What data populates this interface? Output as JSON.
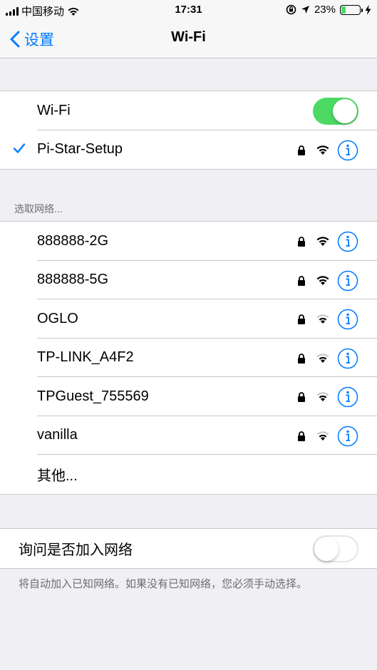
{
  "status": {
    "carrier": "中国移动",
    "time": "17:31",
    "battery_pct": "23%",
    "battery_level": 0.23
  },
  "nav": {
    "back_label": "设置",
    "title": "Wi-Fi"
  },
  "wifi_section": {
    "toggle_label": "Wi-Fi",
    "toggle_on": true,
    "connected": "Pi-Star-Setup"
  },
  "choose_header": "选取网络...",
  "networks": [
    {
      "name": "888888-2G",
      "strength": 3
    },
    {
      "name": "888888-5G",
      "strength": 3
    },
    {
      "name": "OGLO",
      "strength": 2
    },
    {
      "name": "TP-LINK_A4F2",
      "strength": 2
    },
    {
      "name": "TPGuest_755569",
      "strength": 2
    },
    {
      "name": "vanilla",
      "strength": 2
    }
  ],
  "other_label": "其他...",
  "ask_join": {
    "label": "询问是否加入网络",
    "toggle_on": false,
    "note": "将自动加入已知网络。如果没有已知网络，您必须手动选择。"
  },
  "colors": {
    "accent": "#007aff",
    "toggle_on": "#4cd964",
    "background": "#efeff4"
  }
}
